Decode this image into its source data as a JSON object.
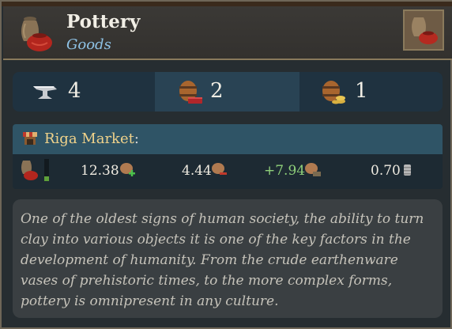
{
  "header": {
    "title": "Pottery",
    "subtitle": "Goods",
    "icon": "pottery-vase-icon"
  },
  "stats": [
    {
      "icon": "anvil-icon",
      "value": "4"
    },
    {
      "icon": "barrel-chest-icon",
      "value": "2"
    },
    {
      "icon": "barrel-coins-icon",
      "value": "1"
    }
  ],
  "market": {
    "title": "Riga Market",
    "colon": ":",
    "stock_level": 0.2,
    "values": [
      {
        "value": "12.38",
        "icon": "goods-plus-icon"
      },
      {
        "value": "4.44",
        "icon": "goods-minus-icon"
      },
      {
        "value": "+7.94",
        "icon": "goods-balance-icon",
        "color": "#8fd07a"
      },
      {
        "value": "0.70",
        "icon": "coin-stack-icon"
      }
    ]
  },
  "description": "One of the oldest signs of human society, the ability to turn clay into various objects it is one of the key factors in the development of humanity. From the crude earthenware vases of prehistoric times, to the more complex forms, pottery is omnipresent in any culture."
}
